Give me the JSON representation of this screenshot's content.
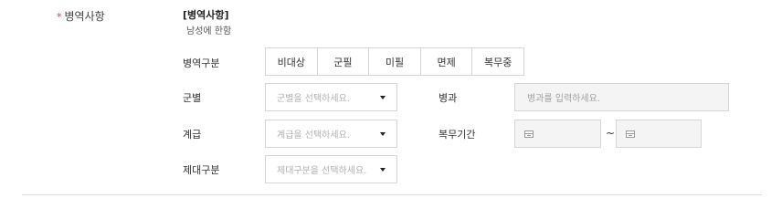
{
  "section": {
    "required_mark": "*",
    "label": "병역사항"
  },
  "notice": {
    "title": "[병역사항]",
    "subtitle": "남성에 한함"
  },
  "service_type": {
    "label": "병역구분",
    "options": [
      "비대상",
      "군필",
      "미필",
      "면제",
      "복무중"
    ]
  },
  "branch": {
    "label": "군별",
    "placeholder": "군별을 선택하세요."
  },
  "specialty": {
    "label": "병과",
    "placeholder": "병과를 입력하세요."
  },
  "rank": {
    "label": "계급",
    "placeholder": "계급을 선택하세요."
  },
  "service_period": {
    "label": "복무기간",
    "separator": "~"
  },
  "discharge_type": {
    "label": "제대구분",
    "placeholder": "제대구분을 선택하세요."
  }
}
